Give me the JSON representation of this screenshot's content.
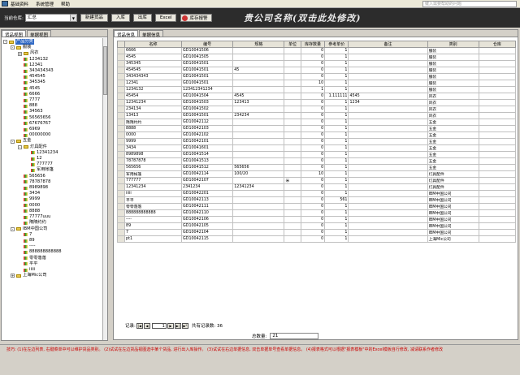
{
  "menu": {
    "items": [
      "基础资料",
      "系统管理",
      "帮助"
    ],
    "search_placeholder": "键入需要帮助的问题"
  },
  "toolbar": {
    "warehouse_label": "当前仓库:",
    "warehouse_value": "汇总",
    "new_btn": "新建货品",
    "in_btn": "入库",
    "out_btn": "出库",
    "excel_btn": "Excel",
    "alarm_btn": "库存报警"
  },
  "company_title": "贵公司名称(双击此处修改)",
  "left": {
    "tabs": [
      "货品视图",
      "单据视图"
    ],
    "tree": [
      {
        "label": "产品分类",
        "level": 0,
        "icon": "folder",
        "sel": true,
        "toggle": "-"
      },
      {
        "label": "服装",
        "level": 1,
        "icon": "folder",
        "toggle": "-"
      },
      {
        "label": "风衣",
        "level": 2,
        "icon": "folder",
        "toggle": "+"
      },
      {
        "label": "1234132",
        "level": 2,
        "icon": "leaf"
      },
      {
        "label": "12341",
        "level": 2,
        "icon": "leaf"
      },
      {
        "label": "343434343",
        "level": 2,
        "icon": "leaf"
      },
      {
        "label": "454545",
        "level": 2,
        "icon": "leaf"
      },
      {
        "label": "345345",
        "level": 2,
        "icon": "leaf"
      },
      {
        "label": "4545",
        "level": 2,
        "icon": "leaf"
      },
      {
        "label": "6666",
        "level": 2,
        "icon": "leaf"
      },
      {
        "label": "7777",
        "level": 2,
        "icon": "leaf"
      },
      {
        "label": "888",
        "level": 2,
        "icon": "leaf"
      },
      {
        "label": "34563",
        "level": 2,
        "icon": "leaf"
      },
      {
        "label": "56565656",
        "level": 2,
        "icon": "leaf"
      },
      {
        "label": "67676767",
        "level": 2,
        "icon": "leaf"
      },
      {
        "label": "6969",
        "level": 2,
        "icon": "leaf"
      },
      {
        "label": "00000000",
        "level": 2,
        "icon": "leaf"
      },
      {
        "label": "五金",
        "level": 1,
        "icon": "folder",
        "toggle": "-"
      },
      {
        "label": "灯具配件",
        "level": 2,
        "icon": "folder",
        "toggle": "-"
      },
      {
        "label": "12341234",
        "level": 3,
        "icon": "leaf"
      },
      {
        "label": "12",
        "level": 3,
        "icon": "leaf"
      },
      {
        "label": "777777",
        "level": 3,
        "icon": "leaf"
      },
      {
        "label": "军用帐篷",
        "level": 3,
        "icon": "leaf"
      },
      {
        "label": "565656",
        "level": 2,
        "icon": "leaf"
      },
      {
        "label": "78787878",
        "level": 2,
        "icon": "leaf"
      },
      {
        "label": "8989898",
        "level": 2,
        "icon": "leaf"
      },
      {
        "label": "3434",
        "level": 2,
        "icon": "leaf"
      },
      {
        "label": "9999",
        "level": 2,
        "icon": "leaf"
      },
      {
        "label": "0000",
        "level": 2,
        "icon": "leaf"
      },
      {
        "label": "8888",
        "level": 2,
        "icon": "leaf"
      },
      {
        "label": "77777uuu",
        "level": 2,
        "icon": "leaf"
      },
      {
        "label": "隋隋约约",
        "level": 2,
        "icon": "leaf"
      },
      {
        "label": "IBM中国公司",
        "level": 1,
        "icon": "folder",
        "toggle": "-"
      },
      {
        "label": "7",
        "level": 2,
        "icon": "leaf"
      },
      {
        "label": "89",
        "level": 2,
        "icon": "leaf"
      },
      {
        "label": "----",
        "level": 2,
        "icon": "leaf"
      },
      {
        "label": "888888888888",
        "level": 2,
        "icon": "leaf"
      },
      {
        "label": "零零落落",
        "level": 2,
        "icon": "leaf"
      },
      {
        "label": "平平",
        "level": 2,
        "icon": "leaf"
      },
      {
        "label": "iiiii",
        "level": 2,
        "icon": "leaf"
      },
      {
        "label": "上海Mic公司",
        "level": 1,
        "icon": "folder",
        "toggle": "+"
      }
    ]
  },
  "right": {
    "tabs": [
      "货品信息",
      "单据信息"
    ],
    "columns": [
      "名称",
      "编号",
      "规格",
      "单位",
      "库存数量",
      "参考单价",
      "备注",
      "类别",
      "仓库"
    ],
    "rows": [
      [
        "6666",
        "GD10041506",
        "",
        "",
        "0",
        "1",
        "",
        "服装",
        ""
      ],
      [
        "4545",
        "GD10041505",
        "",
        "",
        "0",
        "1",
        "",
        "服装",
        ""
      ],
      [
        "345345",
        "GD10041501",
        "",
        "",
        "0",
        "1",
        "",
        "服装",
        ""
      ],
      [
        "454545",
        "GD10041501",
        "45",
        "",
        "0",
        "1",
        "",
        "服装",
        ""
      ],
      [
        "343434343",
        "GD10041501",
        "",
        "",
        "0",
        "1",
        "",
        "服装",
        ""
      ],
      [
        "12341",
        "GD10041501",
        "",
        "",
        "10",
        "1",
        "",
        "服装",
        ""
      ],
      [
        "1234132",
        "123412341234",
        "",
        "",
        "1",
        "1",
        "",
        "服装",
        ""
      ],
      [
        "45454",
        "GD10041504",
        "4545",
        "",
        "0",
        "1.111111",
        "4545",
        "风衣",
        ""
      ],
      [
        "12341234",
        "GD10041503",
        "123413",
        "",
        "0",
        "1",
        "1234",
        "风衣",
        ""
      ],
      [
        "234134",
        "GD10041502",
        "",
        "",
        "0",
        "1",
        "",
        "风衣",
        ""
      ],
      [
        "13413",
        "GD10041501",
        "234234",
        "",
        "0",
        "1",
        "",
        "风衣",
        ""
      ],
      [
        "隋隋约约",
        "GD10042112",
        "",
        "",
        "0",
        "1",
        "",
        "五金",
        ""
      ],
      [
        "8888",
        "GD10042103",
        "",
        "",
        "0",
        "1",
        "",
        "五金",
        ""
      ],
      [
        "0000",
        "GD10042102",
        "",
        "",
        "0",
        "1",
        "",
        "五金",
        ""
      ],
      [
        "9999",
        "GD10042101",
        "",
        "",
        "0",
        "1",
        "",
        "五金",
        ""
      ],
      [
        "3434",
        "GD10041601",
        "",
        "",
        "0",
        "1",
        "",
        "五金",
        ""
      ],
      [
        "8989898",
        "GD10041514",
        "",
        "",
        "0",
        "1",
        "",
        "五金",
        ""
      ],
      [
        "78787878",
        "GD10041513",
        "",
        "",
        "0",
        "1",
        "",
        "五金",
        ""
      ],
      [
        "565656",
        "GD10041512",
        "565656",
        "",
        "0",
        "1",
        "",
        "五金",
        ""
      ],
      [
        "军用帐篷",
        "GD10042114",
        "100/20",
        "",
        "10",
        "1",
        "",
        "灯具配件",
        ""
      ],
      [
        "777777",
        "GD10042107",
        "",
        "米",
        "0",
        "1",
        "",
        "灯具配件",
        ""
      ],
      [
        "12341234",
        "2341234",
        "12341234",
        "",
        "0",
        "1",
        "",
        "灯具配件",
        ""
      ],
      [
        "iiiii",
        "GD10042201",
        "",
        "",
        "0",
        "1",
        "",
        "IBM中国公司",
        ""
      ],
      [
        "平平",
        "GD10042113",
        "",
        "",
        "0",
        "561",
        "",
        "IBM中国公司",
        ""
      ],
      [
        "零零落落",
        "GD10042111",
        "",
        "",
        "0",
        "1",
        "",
        "IBM中国公司",
        ""
      ],
      [
        "888888888888",
        "GD10042110",
        "",
        "",
        "0",
        "1",
        "",
        "IBM中国公司",
        ""
      ],
      [
        "----",
        "GD10042106",
        "",
        "",
        "0",
        "1",
        "",
        "IBM中国公司",
        ""
      ],
      [
        "89",
        "GD10042105",
        "",
        "",
        "0",
        "1",
        "",
        "IBM中国公司",
        ""
      ],
      [
        "7",
        "GD10042104",
        "",
        "",
        "0",
        "1",
        "",
        "IBM中国公司",
        ""
      ],
      [
        "pt1",
        "GD10042115",
        "",
        "",
        "0",
        "1",
        "",
        "上海Mic公司",
        ""
      ]
    ],
    "nav": {
      "label": "记录:",
      "page": "1",
      "total_text": "共有记录数: 36"
    },
    "total_label": "总数量:",
    "total_value": "21"
  },
  "status_text": "技巧: (1)在左边列表, 右键菜单中可以维护货品类别。 (2)试试在左边货品视图选中某个货品, 进行出入库操作。 (3)试试在右边单据信息, 双击单据单号查看单据信息。 (4)报表格式可以根据\"报表模板\"中的Excel模板自行修改, 减请联系作者修改"
}
